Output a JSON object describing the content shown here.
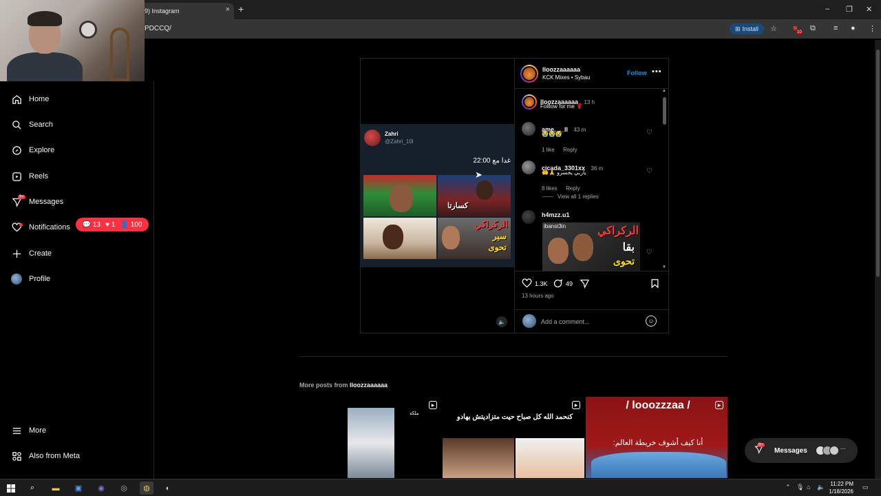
{
  "browser": {
    "tab_title": "9) Instagram",
    "tab_close": "×",
    "new_tab": "+",
    "url": "PDCCQ/",
    "install_label": "Install",
    "extension_badge": "10",
    "window_controls": [
      "–",
      "❐",
      "✕"
    ]
  },
  "sidebar": {
    "items": [
      {
        "label": "Home",
        "icon": "home-icon"
      },
      {
        "label": "Search",
        "icon": "search-icon"
      },
      {
        "label": "Explore",
        "icon": "compass-icon"
      },
      {
        "label": "Reels",
        "icon": "reels-icon"
      },
      {
        "label": "Messages",
        "icon": "messenger-icon",
        "badge": "9+"
      },
      {
        "label": "Notifications",
        "icon": "heart-icon"
      },
      {
        "label": "Create",
        "icon": "plus-icon"
      },
      {
        "label": "Profile",
        "icon": "avatar"
      }
    ],
    "notif_pill": {
      "comments": "13",
      "likes": "1",
      "follows": "100"
    },
    "bottom_items": [
      {
        "label": "More",
        "icon": "menu-icon"
      },
      {
        "label": "Also from Meta",
        "icon": "meta-icon"
      }
    ]
  },
  "post": {
    "tweet": {
      "name": "Zahri",
      "handle": "@Zahri_10l",
      "text": "غدا مع 22:00",
      "collage_texts": [
        "كسارتا",
        "الركراكي",
        "سير",
        "تحوى"
      ]
    },
    "author": "lloozzaaaaaa",
    "audio": "KCK Mixes • Sybau",
    "follow_label": "Follow",
    "more_label": "•••",
    "caption": {
      "user": "lloozzaaaaaa",
      "time": "13 h",
      "text": "Folllow for me 🌹"
    },
    "comments": [
      {
        "user": "ame._._ll",
        "time": "43 m",
        "text": "😭😭😭",
        "likes": "1 like",
        "reply": "Reply"
      },
      {
        "user": "cicada_3301xx",
        "time": "36 m",
        "text": "🤲🙏 ياربي يخسرو",
        "likes": "8 likes",
        "reply": "Reply",
        "view_replies": "View all 1 replies"
      },
      {
        "user": "h4mzz.u1",
        "text": "ibanst3in",
        "thumb_texts": [
          "الركراكي",
          "بقا",
          "تحوى"
        ]
      }
    ],
    "like_count": "1.3K",
    "comment_count": "49",
    "time_ago": "13 hours ago",
    "comment_placeholder": "Add a comment..."
  },
  "more_posts": {
    "prefix": "More posts from",
    "user": "lloozzaaaaaa",
    "items": [
      {
        "text": "ملكة"
      },
      {
        "text": "كنحمد الله كل صباح حيت متزاديتش بهادو"
      },
      {
        "text_top": "/ looozzzaa /",
        "text_bottom": "أنا كيف أشوف خريطة العالم:"
      }
    ]
  },
  "messages_pill": {
    "label": "Messages",
    "badge": "9+"
  },
  "taskbar": {
    "time": "11:22 PM",
    "date": "1/18/2026"
  },
  "colors": {
    "accent_blue": "#0095f6",
    "notification_red": "#ff3040",
    "background": "#000000"
  }
}
